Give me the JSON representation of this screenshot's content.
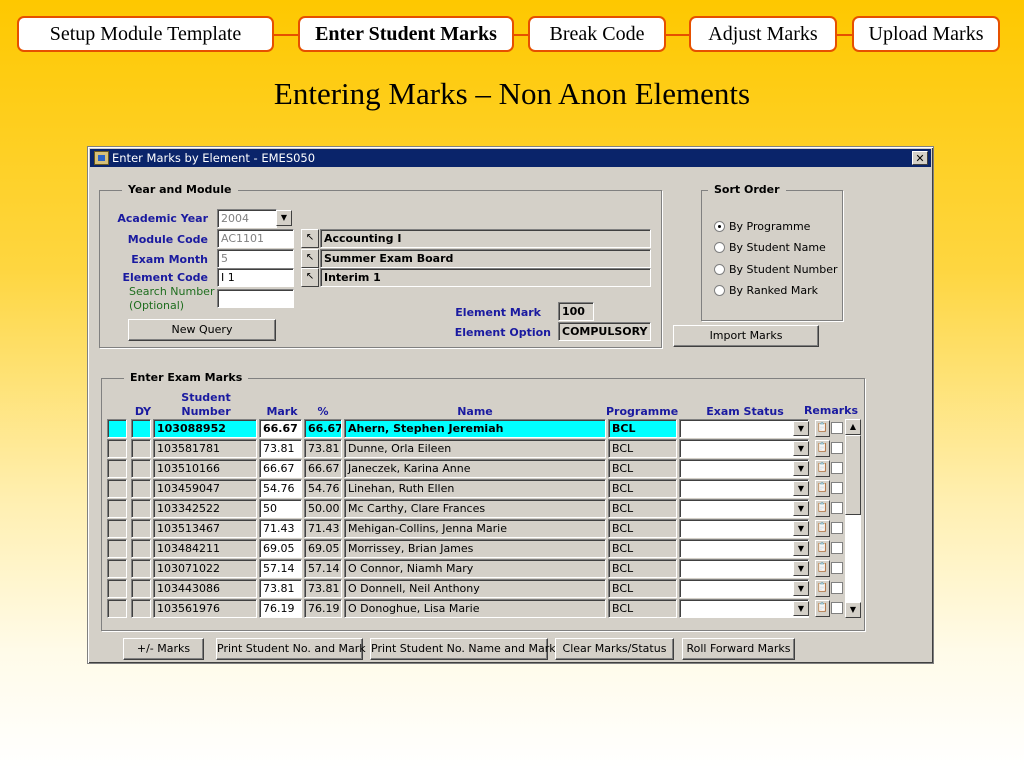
{
  "flow": {
    "steps": [
      {
        "label": "Setup Module Template"
      },
      {
        "label": "Enter Student Marks"
      },
      {
        "label": "Break Code"
      },
      {
        "label": "Adjust Marks"
      },
      {
        "label": "Upload Marks"
      }
    ],
    "active_step": "Enter Student Marks"
  },
  "slide_title": "Entering Marks – Non Anon Elements",
  "window": {
    "title": "Enter Marks by Element - EMES050",
    "close_glyph": "✕"
  },
  "year_module": {
    "legend": "Year and Module",
    "academic_year": {
      "label": "Academic Year",
      "value": "2004"
    },
    "module_code": {
      "label": "Module Code",
      "value": "AC1101",
      "description": "Accounting I"
    },
    "exam_month": {
      "label": "Exam Month",
      "value": "5",
      "description": "Summer Exam Board"
    },
    "element_code": {
      "label": "Element Code",
      "value": "I 1",
      "description": "Interim 1"
    },
    "search_number": {
      "label_line1": "Search Number",
      "label_line2": "(Optional)",
      "value": ""
    },
    "new_query": "New Query",
    "element_mark": {
      "label": "Element Mark",
      "value": "100"
    },
    "element_option": {
      "label": "Element Option",
      "value": "COMPULSORY"
    }
  },
  "sort_order": {
    "legend": "Sort Order",
    "options": [
      "By Programme",
      "By Student Name",
      "By Student Number",
      "By Ranked Mark"
    ],
    "selected": "By Programme"
  },
  "import_marks": "Import Marks",
  "exam_marks": {
    "legend": "Enter Exam Marks",
    "headers": {
      "dy": "DY",
      "student_number_line1": "Student",
      "student_number_line2": "Number",
      "mark": "Mark",
      "percent": "%",
      "name": "Name",
      "programme": "Programme",
      "exam_status": "Exam Status",
      "remarks": "Remarks"
    },
    "rows": [
      {
        "student": "103088952",
        "mark": "66.67",
        "pct": "66.67",
        "name": "Ahern, Stephen Jeremiah",
        "prog": "BCL",
        "status": ""
      },
      {
        "student": "103581781",
        "mark": "73.81",
        "pct": "73.81",
        "name": "Dunne, Orla Eileen",
        "prog": "BCL",
        "status": ""
      },
      {
        "student": "103510166",
        "mark": "66.67",
        "pct": "66.67",
        "name": "Janeczek, Karina Anne",
        "prog": "BCL",
        "status": ""
      },
      {
        "student": "103459047",
        "mark": "54.76",
        "pct": "54.76",
        "name": "Linehan, Ruth Ellen",
        "prog": "BCL",
        "status": ""
      },
      {
        "student": "103342522",
        "mark": "50",
        "pct": "50.00",
        "name": "Mc Carthy, Clare Frances",
        "prog": "BCL",
        "status": ""
      },
      {
        "student": "103513467",
        "mark": "71.43",
        "pct": "71.43",
        "name": "Mehigan-Collins, Jenna Marie",
        "prog": "BCL",
        "status": ""
      },
      {
        "student": "103484211",
        "mark": "69.05",
        "pct": "69.05",
        "name": "Morrissey, Brian James",
        "prog": "BCL",
        "status": ""
      },
      {
        "student": "103071022",
        "mark": "57.14",
        "pct": "57.14",
        "name": "O Connor, Niamh Mary",
        "prog": "BCL",
        "status": ""
      },
      {
        "student": "103443086",
        "mark": "73.81",
        "pct": "73.81",
        "name": "O Donnell, Neil Anthony",
        "prog": "BCL",
        "status": ""
      },
      {
        "student": "103561976",
        "mark": "76.19",
        "pct": "76.19",
        "name": "O Donoghue, Lisa Marie",
        "prog": "BCL",
        "status": ""
      }
    ],
    "current_row": 0
  },
  "buttons": {
    "plus_minus_marks": "+/- Marks",
    "print_no_mark": "Print Student No. and Mark",
    "print_no_name_mark": "Print Student No. Name and Mark",
    "clear_marks": "Clear Marks/Status",
    "roll_forward": "Roll Forward Marks"
  },
  "icons": {
    "lov": "lov-arrow-icon",
    "dropdown": "chevron-down-icon",
    "remarks": "clipboard-icon",
    "scroll_up": "arrow-up-icon",
    "scroll_down": "arrow-down-icon"
  },
  "colors": {
    "accent": "#e65000",
    "label_blue": "#1a1aa0",
    "label_green": "#1f6e1f",
    "current_row": "#00ffff",
    "titlebar": "#0a246a"
  }
}
